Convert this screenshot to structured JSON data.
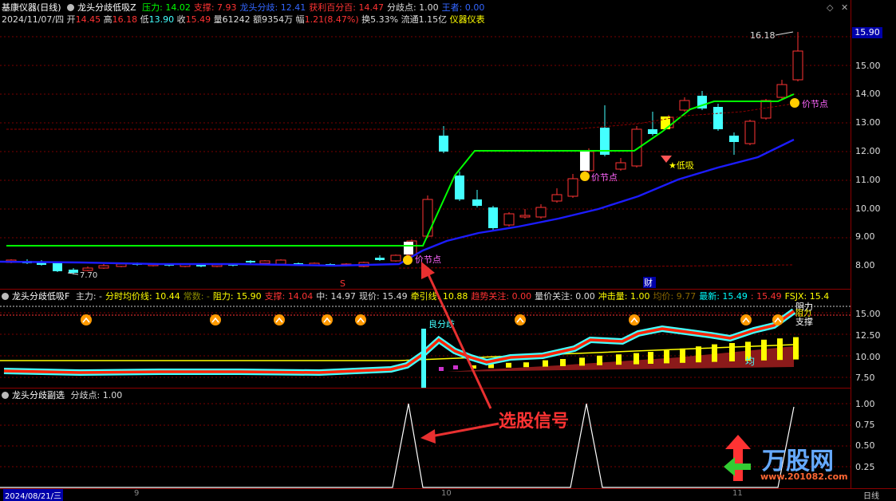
{
  "stock": {
    "name": "基康仪器",
    "period": "(日线)"
  },
  "main_indicator": {
    "name": "龙头分歧低吸Z",
    "items": [
      {
        "label": "压力:",
        "value": "14.02",
        "color": "#00ff00"
      },
      {
        "label": "支撑:",
        "value": "7.93",
        "color": "#ff3333"
      },
      {
        "label": "龙头分歧:",
        "value": "12.41",
        "color": "#3366ff"
      },
      {
        "label": "获利百分百:",
        "value": "14.47",
        "color": "#ff3333"
      },
      {
        "label": "分歧点:",
        "value": "1.00",
        "color": "#dddddd"
      },
      {
        "label": "王者:",
        "value": "0.00",
        "color": "#3366ff"
      }
    ]
  },
  "quote": {
    "date": "2024/11/07/四",
    "open_label": "开",
    "open": "14.45",
    "high_label": "高",
    "high": "16.18",
    "low_label": "低",
    "low": "13.90",
    "close_label": "收",
    "close": "15.49",
    "volume_label": "量",
    "volume": "61242",
    "amount_label": "额",
    "amount": "9354万",
    "change_label": "幅",
    "change": "1.21(8.47%)",
    "turnover_label": "换",
    "turnover": "5.33%",
    "float_label": "流通",
    "float": "1.15亿",
    "sector": "仪器仪表"
  },
  "price_axis": {
    "current": "15.90",
    "ticks": [
      "15.00",
      "14.00",
      "13.00",
      "12.00",
      "11.00",
      "10.00",
      "9.00",
      "8.00"
    ]
  },
  "annotations": {
    "max_label": "16.18",
    "min_label": "7.70",
    "node_label": "价节点",
    "dip_label": "低吸",
    "s_marker": "S",
    "cai_marker": "财"
  },
  "sub1": {
    "name": "龙头分歧低吸F",
    "items": [
      {
        "label": "主力:",
        "value": "-",
        "color": "#dddddd"
      },
      {
        "label": "分时均价线:",
        "value": "10.44",
        "color": "#ffff00"
      },
      {
        "label": "常数:",
        "value": "-",
        "color": "#888800"
      },
      {
        "label": "阻力:",
        "value": "15.90",
        "color": "#ffff00"
      },
      {
        "label": "支撑:",
        "value": "14.04",
        "color": "#ff3333"
      },
      {
        "label": "中:",
        "value": "14.97",
        "color": "#dddddd"
      },
      {
        "label": "现价:",
        "value": "15.49",
        "color": "#dddddd"
      },
      {
        "label": "牵引线:",
        "value": "10.88",
        "color": "#ffff00"
      },
      {
        "label": "趋势关注:",
        "value": "0.00",
        "color": "#ff3333"
      },
      {
        "label": "量价关注:",
        "value": "0.00",
        "color": "#dddddd"
      },
      {
        "label": "冲击量:",
        "value": "1.00",
        "color": "#ffff00"
      },
      {
        "label": "均价:",
        "value": "9.77",
        "color": "#886600"
      },
      {
        "label": "最新:",
        "value": "15.49",
        "color": "#00ffff"
      },
      {
        "label": ":",
        "value": "15.49",
        "color": "#ff3333"
      },
      {
        "label": "FSJX:",
        "value": "15.4",
        "color": "#ffff00"
      }
    ],
    "ticks": [
      "15.00",
      "12.50",
      "10.00",
      "7.50"
    ],
    "labels": {
      "liang": "良分歧",
      "jun": "均",
      "zuli": "阻力",
      "zhicheng": "支撑",
      "liang2": "阴力"
    }
  },
  "sub2": {
    "name": "龙头分歧副选",
    "items": [
      {
        "label": "分歧点:",
        "value": "1.00",
        "color": "#dddddd"
      }
    ],
    "ticks": [
      "1.00",
      "0.75",
      "0.50",
      "0.25"
    ]
  },
  "callout": "选股信号",
  "timeline": {
    "start": "2024/08/21/三",
    "m9": "9",
    "m10": "10",
    "m11": "11",
    "period": "日线"
  },
  "watermark": {
    "brand": "万股网",
    "url": "www.201082.com"
  },
  "colors": {
    "up": "#ff3333",
    "down": "#44ffff",
    "support": "#00ff00",
    "dragon": "#1c1cff",
    "bg": "#000000"
  }
}
